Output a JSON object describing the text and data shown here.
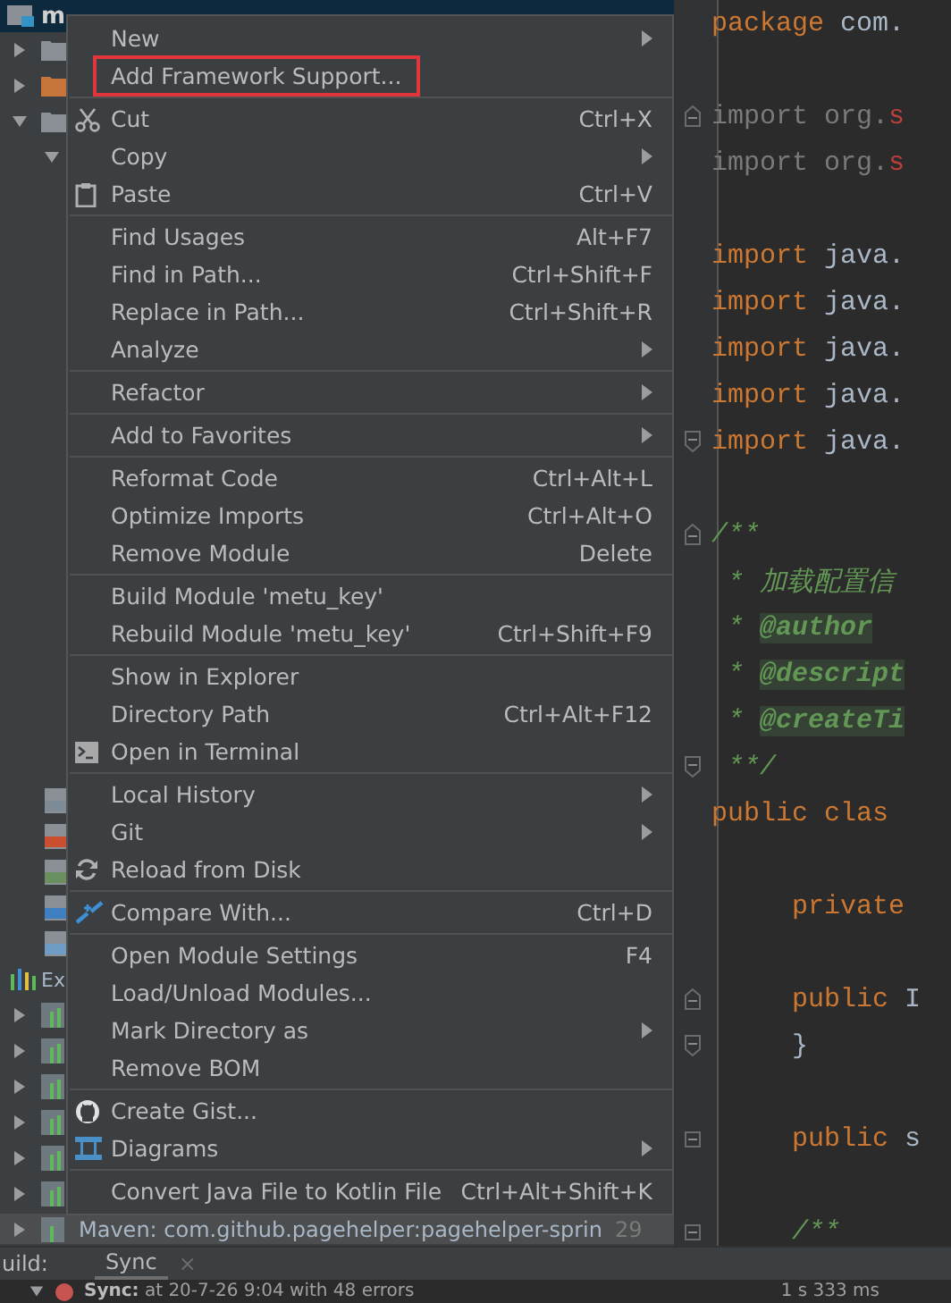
{
  "project_header": {
    "label": "m"
  },
  "tree_top": [
    {
      "kind": "folder",
      "expanded": false
    },
    {
      "kind": "source-folder",
      "expanded": false
    },
    {
      "kind": "folder",
      "expanded": true
    },
    {
      "kind": "sub",
      "expanded": true
    }
  ],
  "tree_bottom": [
    {
      "kind": "config-file"
    },
    {
      "kind": "red-file"
    },
    {
      "kind": "green-file"
    },
    {
      "kind": "maven-file"
    },
    {
      "kind": "iml-file"
    },
    {
      "kind": "external",
      "label": "Ex"
    },
    {
      "kind": "library",
      "expanded": false
    },
    {
      "kind": "library",
      "expanded": false
    },
    {
      "kind": "library",
      "expanded": false
    },
    {
      "kind": "library",
      "expanded": false
    },
    {
      "kind": "library",
      "expanded": false
    },
    {
      "kind": "library",
      "expanded": false
    }
  ],
  "maven_row": {
    "label": "Maven: com.github.pagehelper:pagehelper-sprin",
    "count": "29"
  },
  "context_menu": {
    "groups": [
      [
        {
          "label": "New",
          "submenu": true,
          "kind": "plain",
          "outlined": false
        },
        {
          "label": "Add Framework Support...",
          "submenu": false,
          "kind": "plain",
          "outlined": true
        }
      ],
      [
        {
          "label": "Cut",
          "shortcut": "Ctrl+X",
          "submenu": false,
          "kind": "cut",
          "outlined": false
        },
        {
          "label": "Copy",
          "submenu": true,
          "kind": "plain",
          "outlined": false
        },
        {
          "label": "Paste",
          "shortcut": "Ctrl+V",
          "submenu": false,
          "kind": "paste",
          "outlined": false
        }
      ],
      [
        {
          "label": "Find Usages",
          "shortcut": "Alt+F7",
          "submenu": false,
          "kind": "plain",
          "outlined": false
        },
        {
          "label": "Find in Path...",
          "shortcut": "Ctrl+Shift+F",
          "submenu": false,
          "kind": "plain",
          "outlined": false
        },
        {
          "label": "Replace in Path...",
          "shortcut": "Ctrl+Shift+R",
          "submenu": false,
          "kind": "plain",
          "outlined": false
        },
        {
          "label": "Analyze",
          "submenu": true,
          "kind": "plain",
          "outlined": false
        }
      ],
      [
        {
          "label": "Refactor",
          "submenu": true,
          "kind": "plain",
          "outlined": false
        }
      ],
      [
        {
          "label": "Add to Favorites",
          "submenu": true,
          "kind": "plain",
          "outlined": false
        }
      ],
      [
        {
          "label": "Reformat Code",
          "shortcut": "Ctrl+Alt+L",
          "submenu": false,
          "kind": "plain",
          "outlined": false
        },
        {
          "label": "Optimize Imports",
          "shortcut": "Ctrl+Alt+O",
          "submenu": false,
          "kind": "plain",
          "outlined": false
        },
        {
          "label": "Remove Module",
          "shortcut": "Delete",
          "submenu": false,
          "kind": "plain",
          "outlined": false
        }
      ],
      [
        {
          "label": "Build Module 'metu_key'",
          "submenu": false,
          "kind": "plain",
          "outlined": false
        },
        {
          "label": "Rebuild Module 'metu_key'",
          "shortcut": "Ctrl+Shift+F9",
          "submenu": false,
          "kind": "plain",
          "outlined": false
        }
      ],
      [
        {
          "label": "Show in Explorer",
          "submenu": false,
          "kind": "plain",
          "outlined": false
        },
        {
          "label": "Directory Path",
          "shortcut": "Ctrl+Alt+F12",
          "submenu": false,
          "kind": "plain",
          "outlined": false
        },
        {
          "label": "Open in Terminal",
          "submenu": false,
          "kind": "terminal",
          "outlined": false
        }
      ],
      [
        {
          "label": "Local History",
          "submenu": true,
          "kind": "plain",
          "outlined": false
        },
        {
          "label": "Git",
          "submenu": true,
          "kind": "plain",
          "outlined": false
        },
        {
          "label": "Reload from Disk",
          "submenu": false,
          "kind": "reload",
          "outlined": false
        }
      ],
      [
        {
          "label": "Compare With...",
          "shortcut": "Ctrl+D",
          "submenu": false,
          "kind": "compare",
          "outlined": false
        }
      ],
      [
        {
          "label": "Open Module Settings",
          "shortcut": "F4",
          "submenu": false,
          "kind": "plain",
          "outlined": false
        },
        {
          "label": "Load/Unload Modules...",
          "submenu": false,
          "kind": "plain",
          "outlined": false
        },
        {
          "label": "Mark Directory as",
          "submenu": true,
          "kind": "plain",
          "outlined": false
        },
        {
          "label": "Remove BOM",
          "submenu": false,
          "kind": "plain",
          "outlined": false
        }
      ],
      [
        {
          "label": "Create Gist...",
          "submenu": false,
          "kind": "github",
          "outlined": false
        },
        {
          "label": "Diagrams",
          "submenu": true,
          "kind": "diagram",
          "outlined": false
        }
      ],
      [
        {
          "label": "Convert Java File to Kotlin File",
          "shortcut": "Ctrl+Alt+Shift+K",
          "submenu": false,
          "kind": "plain",
          "outlined": false
        }
      ]
    ]
  },
  "editor": {
    "lines": [
      {
        "kind": "code",
        "tokens": [
          {
            "kind": "keyword",
            "text": "package"
          },
          {
            "kind": "plain",
            "text": " com."
          }
        ]
      },
      {
        "kind": "blank"
      },
      {
        "kind": "code",
        "fold_top": true,
        "tokens": [
          {
            "kind": "unused",
            "text": "import org."
          },
          {
            "kind": "error",
            "text": "s"
          }
        ]
      },
      {
        "kind": "code",
        "tokens": [
          {
            "kind": "unused",
            "text": "import org."
          },
          {
            "kind": "error",
            "text": "s"
          }
        ]
      },
      {
        "kind": "blank"
      },
      {
        "kind": "code",
        "tokens": [
          {
            "kind": "keyword",
            "text": "import"
          },
          {
            "kind": "plain",
            "text": " java."
          }
        ]
      },
      {
        "kind": "code",
        "tokens": [
          {
            "kind": "keyword",
            "text": "import"
          },
          {
            "kind": "plain",
            "text": " java."
          }
        ]
      },
      {
        "kind": "code",
        "tokens": [
          {
            "kind": "keyword",
            "text": "import"
          },
          {
            "kind": "plain",
            "text": " java."
          }
        ]
      },
      {
        "kind": "code",
        "tokens": [
          {
            "kind": "keyword",
            "text": "import"
          },
          {
            "kind": "plain",
            "text": " java."
          }
        ]
      },
      {
        "kind": "code",
        "fold_bottom": true,
        "tokens": [
          {
            "kind": "keyword",
            "text": "import"
          },
          {
            "kind": "plain",
            "text": " java."
          }
        ]
      },
      {
        "kind": "blank"
      },
      {
        "kind": "code",
        "fold_top": true,
        "tokens": [
          {
            "kind": "doc",
            "text": "/**"
          }
        ]
      },
      {
        "kind": "code",
        "tokens": [
          {
            "kind": "doc",
            "text": " * 加载配置信"
          }
        ]
      },
      {
        "kind": "code",
        "tokens": [
          {
            "kind": "doc",
            "text": " * "
          },
          {
            "kind": "tag",
            "text": "@author"
          }
        ]
      },
      {
        "kind": "code",
        "tokens": [
          {
            "kind": "doc",
            "text": " * "
          },
          {
            "kind": "tag",
            "text": "@descript"
          }
        ]
      },
      {
        "kind": "code",
        "tokens": [
          {
            "kind": "doc",
            "text": " * "
          },
          {
            "kind": "tag",
            "text": "@createTi"
          }
        ]
      },
      {
        "kind": "code",
        "fold_bottom": true,
        "tokens": [
          {
            "kind": "doc",
            "text": " **/"
          }
        ]
      },
      {
        "kind": "code",
        "tokens": [
          {
            "kind": "keyword",
            "text": "public clas"
          }
        ]
      },
      {
        "kind": "blank"
      },
      {
        "kind": "indented",
        "tokens": [
          {
            "kind": "keyword",
            "text": "private"
          }
        ]
      },
      {
        "kind": "blank"
      },
      {
        "kind": "indented",
        "fold_top": true,
        "tokens": [
          {
            "kind": "keyword",
            "text": "public"
          },
          {
            "kind": "plain",
            "text": " I"
          }
        ]
      },
      {
        "kind": "indented",
        "fold_bottom": true,
        "tokens": [
          {
            "kind": "plain",
            "text": "}"
          }
        ]
      },
      {
        "kind": "blank"
      },
      {
        "kind": "indented",
        "fold_box": true,
        "tokens": [
          {
            "kind": "keyword",
            "text": "public"
          },
          {
            "kind": "plain",
            "text": " s"
          }
        ]
      },
      {
        "kind": "blank"
      },
      {
        "kind": "indented",
        "fold_box": true,
        "tokens": [
          {
            "kind": "doc",
            "text": "/**"
          }
        ]
      }
    ]
  },
  "build_panel": {
    "title": "uild:",
    "tabs": [
      {
        "label": "Sync",
        "selected": true
      }
    ],
    "close_glyph": "×",
    "row": {
      "expanded": true,
      "error": true,
      "label": "Sync:",
      "message": " at 20-7-26 9:04 with 48 errors",
      "time": "1 s 333 ms"
    }
  }
}
